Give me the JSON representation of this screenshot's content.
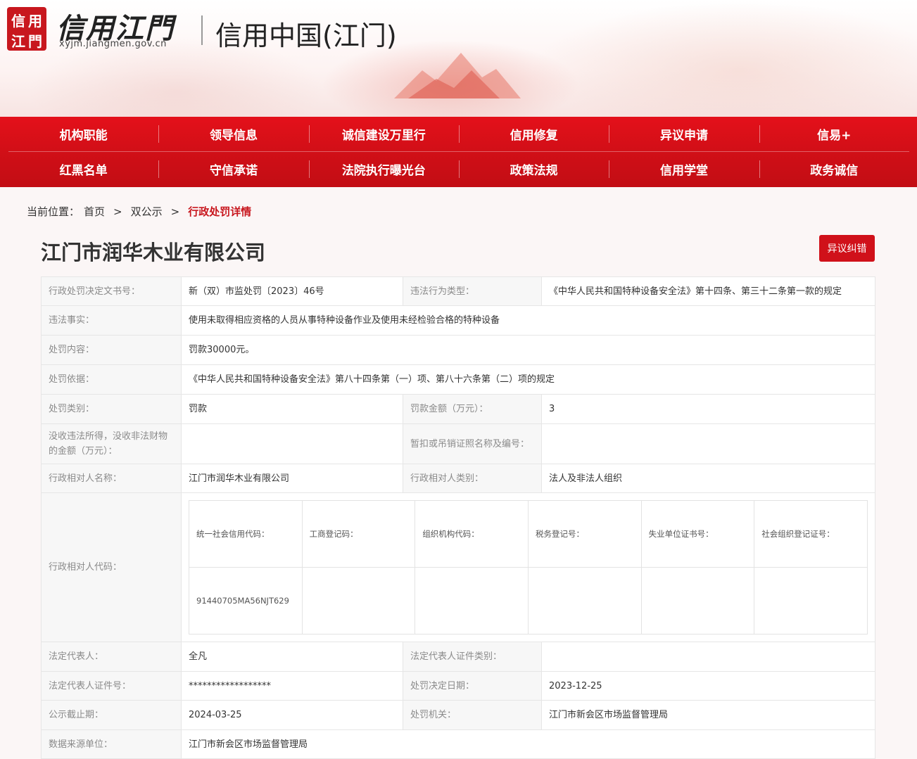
{
  "header": {
    "logo_seal_chars": [
      "信",
      "用",
      "江",
      "門"
    ],
    "logo_text": "信用江門",
    "logo_url": "xyjm.jiangmen.gov.cn",
    "site_title": "信用中国(江门)"
  },
  "nav": {
    "row1": [
      "机构职能",
      "领导信息",
      "诚信建设万里行",
      "信用修复",
      "异议申请",
      "信易+"
    ],
    "row2": [
      "红黑名单",
      "守信承诺",
      "法院执行曝光台",
      "政策法规",
      "信用学堂",
      "政务诚信"
    ]
  },
  "breadcrumb": {
    "prefix": "当前位置：",
    "home": "首页",
    "section": "双公示",
    "current": "行政处罚详情",
    "sep": ">"
  },
  "company": {
    "name": "江门市润华木业有限公司",
    "objection_button": "异议纠错"
  },
  "detail": {
    "decision_no_label": "行政处罚决定文书号：",
    "decision_no": "新（双）市监处罚〔2023〕46号",
    "violation_type_label": "违法行为类型：",
    "violation_type": "《中华人民共和国特种设备安全法》第十四条、第三十二条第一款的规定",
    "facts_label": "违法事实：",
    "facts": "使用未取得相应资格的人员从事特种设备作业及使用未经检验合格的特种设备",
    "content_label": "处罚内容：",
    "content": "罚款30000元。",
    "basis_label": "处罚依据：",
    "basis": "《中华人民共和国特种设备安全法》第八十四条第（一）项、第八十六条第（二）项的规定",
    "category_label": "处罚类别：",
    "category": "罚款",
    "amount_label": "罚款金额（万元）：",
    "amount": "3",
    "confiscation_label": "没收违法所得，没收非法财物的金额（万元）：",
    "confiscation": "",
    "license_label": "暂扣或吊销证照名称及编号：",
    "license": "",
    "party_name_label": "行政相对人名称：",
    "party_name": "江门市润华木业有限公司",
    "party_type_label": "行政相对人类别：",
    "party_type": "法人及非法人组织",
    "party_code_label": "行政相对人代码：",
    "codes": {
      "headers": [
        "统一社会信用代码：",
        "工商登记码：",
        "组织机构代码：",
        "税务登记号：",
        "失业单位证书号：",
        "社会组织登记证号："
      ],
      "values": [
        "91440705MA56NJT629",
        "",
        "",
        "",
        "",
        ""
      ]
    },
    "legal_rep_label": "法定代表人：",
    "legal_rep": "全凡",
    "legal_rep_id_type_label": "法定代表人证件类别：",
    "legal_rep_id_type": "",
    "legal_rep_id_label": "法定代表人证件号：",
    "legal_rep_id": "******************",
    "decision_date_label": "处罚决定日期：",
    "decision_date": "2023-12-25",
    "publish_deadline_label": "公示截止期：",
    "publish_deadline": "2024-03-25",
    "authority_label": "处罚机关：",
    "authority": "江门市新会区市场监督管理局",
    "source_label": "数据来源单位：",
    "source": "江门市新会区市场监督管理局"
  },
  "colors": {
    "brand_red": "#d0111a",
    "label_bg": "#f7f7f7",
    "label_text": "#8a8a8a"
  }
}
